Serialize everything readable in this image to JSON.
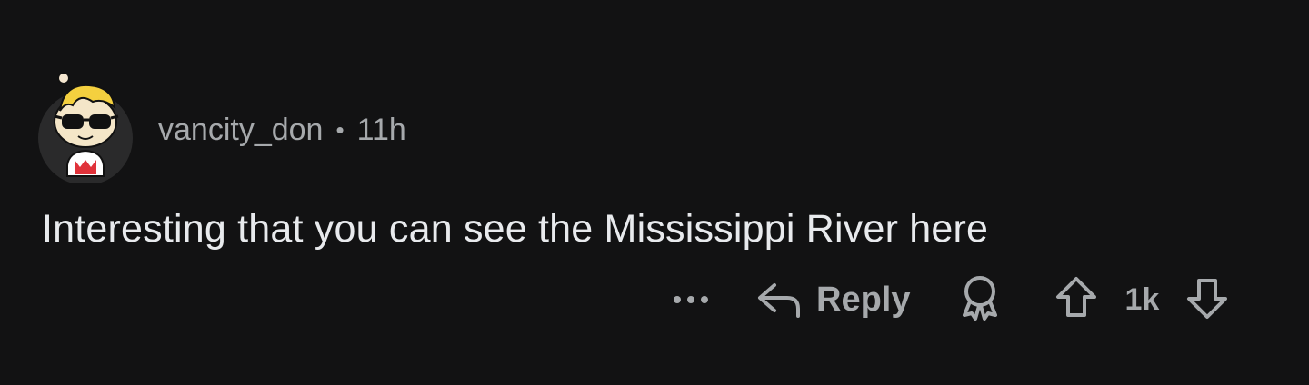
{
  "comment": {
    "username": "vancity_don",
    "separator": "•",
    "age": "11h",
    "text": "Interesting that you can see the Mississippi River here"
  },
  "actions": {
    "more_icon": "more-dots-icon",
    "reply_label": "Reply",
    "reply_icon": "reply-arrow-icon",
    "award_icon": "award-icon",
    "upvote_icon": "upvote-arrow-icon",
    "vote_count": "1k",
    "downvote_icon": "downvote-arrow-icon"
  },
  "colors": {
    "background": "#121213",
    "meta_text": "#a6a9ac",
    "body_text": "#e8eaed"
  }
}
